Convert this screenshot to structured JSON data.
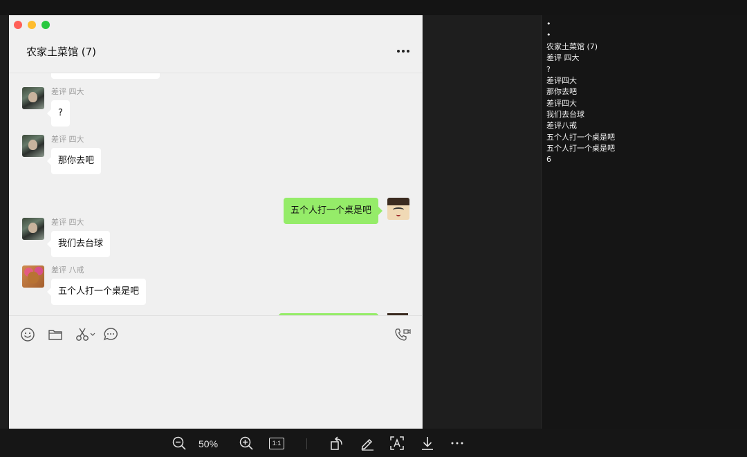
{
  "chat": {
    "title": "农家土菜馆 (7)",
    "messages": [
      {
        "sender": "差评 四大",
        "text": "?",
        "mine": false
      },
      {
        "sender": "差评 四大",
        "text": "那你去吧",
        "mine": false
      },
      {
        "sender": "",
        "text": "五个人打一个桌是吧",
        "mine": true
      },
      {
        "sender": "差评 四大",
        "text": "我们去台球",
        "mine": false
      },
      {
        "sender": "差评 八戒",
        "text": "五个人打一个桌是吧",
        "mine": false
      }
    ]
  },
  "side_panel": {
    "lines": [
      "•",
      "•",
      "农家土菜馆 (7)",
      "差评 四大",
      "?",
      "差评四大",
      "那你去吧",
      "差评四大",
      "我们去台球",
      "差评八戒",
      "五个人打一个桌是吧",
      "五个人打一个桌是吧",
      "6"
    ]
  },
  "toolbar": {
    "zoom": "50%",
    "one_to_one": "1:1"
  },
  "colors": {
    "my_bubble": "#95ec69",
    "their_bubble": "#ffffff",
    "chat_bg": "#f0f0f0",
    "viewer_bg": "#1e1e1e"
  },
  "icons": {
    "input_tools": [
      "emoji-icon",
      "folder-icon",
      "scissors-icon",
      "chat-history-icon",
      "voice-video-call-icon"
    ],
    "bottom_tools": [
      "zoom-out-icon",
      "zoom-in-icon",
      "actual-size-icon",
      "rotate-icon",
      "edit-pen-icon",
      "text-recognition-icon",
      "download-icon",
      "more-icon"
    ]
  }
}
